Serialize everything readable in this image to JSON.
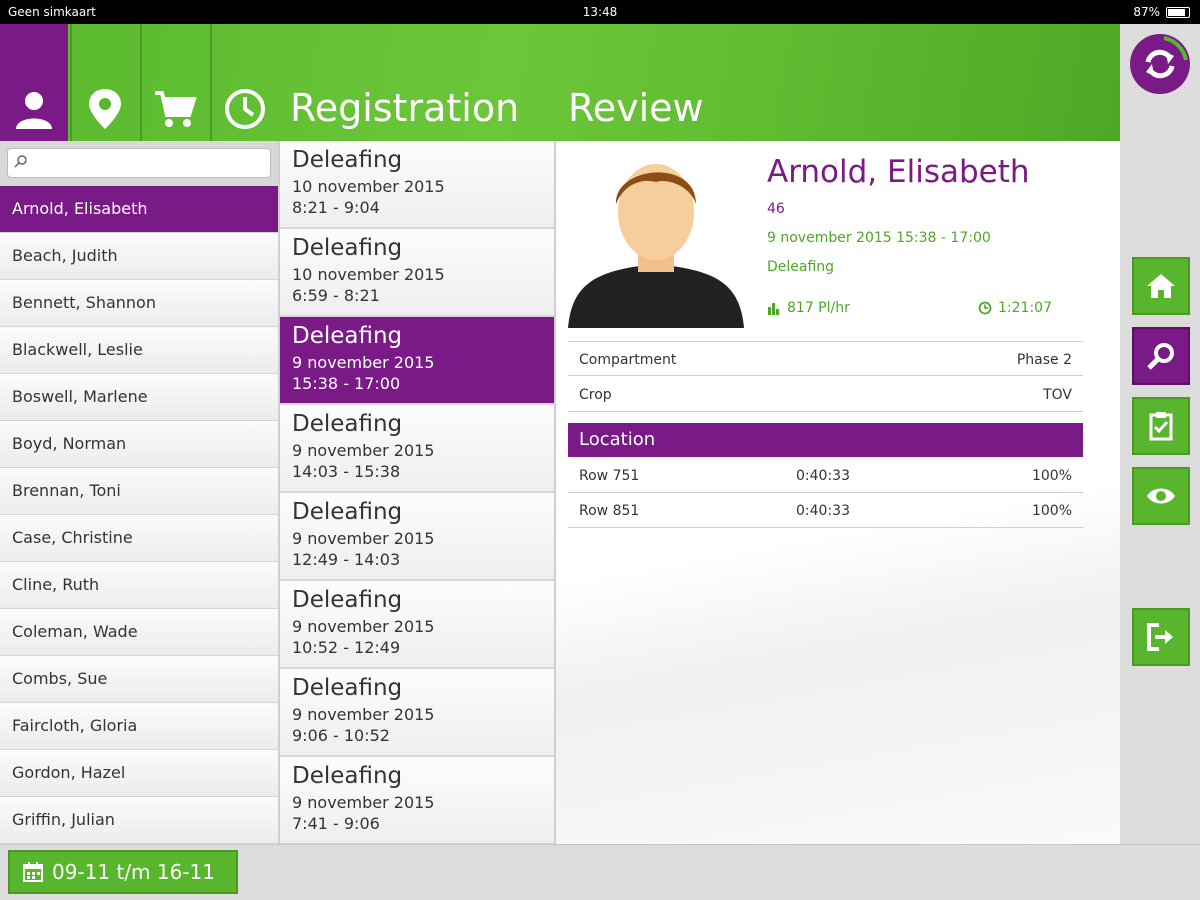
{
  "statusbar": {
    "carrier": "Geen simkaart",
    "time": "13:48",
    "battery": "87%",
    "battery_level": 0.87
  },
  "header": {
    "tabs": [
      {
        "icon": "person-icon",
        "active": true
      },
      {
        "icon": "location-pin-icon",
        "active": false
      },
      {
        "icon": "cart-icon",
        "active": false
      },
      {
        "icon": "clock-icon",
        "active": false
      }
    ],
    "registration_label": "Registration",
    "review_label": "Review"
  },
  "search": {
    "placeholder": "",
    "value": ""
  },
  "people": [
    {
      "name": "Arnold, Elisabeth",
      "active": true
    },
    {
      "name": "Beach, Judith"
    },
    {
      "name": "Bennett, Shannon"
    },
    {
      "name": "Blackwell, Leslie"
    },
    {
      "name": "Boswell, Marlene"
    },
    {
      "name": "Boyd, Norman"
    },
    {
      "name": "Brennan, Toni"
    },
    {
      "name": "Case, Christine"
    },
    {
      "name": "Cline, Ruth"
    },
    {
      "name": "Coleman, Wade"
    },
    {
      "name": "Combs, Sue"
    },
    {
      "name": "Faircloth, Gloria"
    },
    {
      "name": "Gordon, Hazel"
    },
    {
      "name": "Griffin, Julian"
    }
  ],
  "sessions": [
    {
      "activity": "Deleafing",
      "date": "10 november 2015",
      "time": "8:21 - 9:04"
    },
    {
      "activity": "Deleafing",
      "date": "10 november 2015",
      "time": "6:59 - 8:21"
    },
    {
      "activity": "Deleafing",
      "date": "9 november 2015",
      "time": "15:38 - 17:00",
      "active": true
    },
    {
      "activity": "Deleafing",
      "date": "9 november 2015",
      "time": "14:03 - 15:38"
    },
    {
      "activity": "Deleafing",
      "date": "9 november 2015",
      "time": "12:49 - 14:03"
    },
    {
      "activity": "Deleafing",
      "date": "9 november 2015",
      "time": "10:52 - 12:49"
    },
    {
      "activity": "Deleafing",
      "date": "9 november 2015",
      "time": "9:06 - 10:52"
    },
    {
      "activity": "Deleafing",
      "date": "9 november 2015",
      "time": "7:41 - 9:06"
    }
  ],
  "detail": {
    "name": "Arnold, Elisabeth",
    "id": "46",
    "datetime": "9 november 2015 15:38 - 17:00",
    "activity": "Deleafing",
    "rate": "817 Pl/hr",
    "duration": "1:21:07",
    "compartment_label": "Compartment",
    "compartment_value": "Phase 2",
    "crop_label": "Crop",
    "crop_value": "TOV",
    "location_header": "Location",
    "locations": [
      {
        "row": "Row 751",
        "time": "0:40:33",
        "percent": "100%"
      },
      {
        "row": "Row 851",
        "time": "0:40:33",
        "percent": "100%"
      }
    ]
  },
  "rail": {
    "logo_icon": "sync-logo-icon",
    "buttons": [
      {
        "icon": "home-icon"
      },
      {
        "icon": "search-icon",
        "active": true
      },
      {
        "icon": "clipboard-check-icon"
      },
      {
        "icon": "eye-icon"
      },
      {
        "icon": "logout-icon"
      }
    ]
  },
  "footer": {
    "date_range": "09-11 t/m 16-11"
  },
  "colors": {
    "primary_green": "#5ab52e",
    "primary_purple": "#7a1a86",
    "text_dark": "#333333"
  }
}
